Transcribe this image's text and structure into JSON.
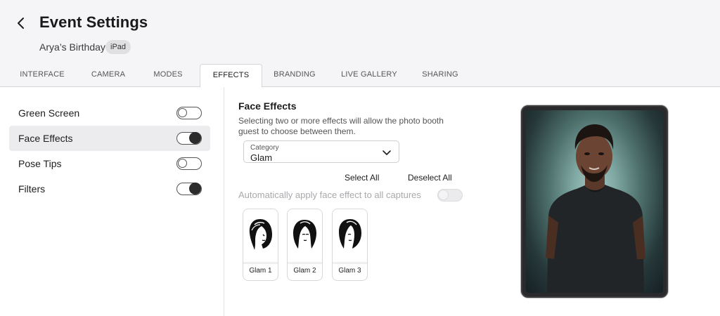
{
  "header": {
    "title": "Event Settings",
    "event_name": "Arya’s Birthday",
    "device_badge": "iPad"
  },
  "tabs": [
    {
      "label": "INTERFACE"
    },
    {
      "label": "CAMERA"
    },
    {
      "label": "MODES"
    },
    {
      "label": "EFFECTS",
      "active": true
    },
    {
      "label": "BRANDING"
    },
    {
      "label": "LIVE GALLERY"
    },
    {
      "label": "SHARING"
    }
  ],
  "sidebar": {
    "items": [
      {
        "label": "Green Screen",
        "on": false
      },
      {
        "label": "Face Effects",
        "on": true,
        "selected": true
      },
      {
        "label": "Pose Tips",
        "on": false
      },
      {
        "label": "Filters",
        "on": true
      }
    ]
  },
  "face_effects": {
    "title": "Face Effects",
    "description": "Selecting two or more effects will allow the photo booth guest to choose between them.",
    "category": {
      "label": "Category",
      "value": "Glam"
    },
    "select_all": "Select All",
    "deselect_all": "Deselect All",
    "auto_apply_label": "Automatically apply face effect to all captures",
    "auto_apply_on": false,
    "effects": [
      {
        "label": "Glam 1",
        "icon": "woman-silhouette-icon"
      },
      {
        "label": "Glam 2",
        "icon": "woman-silhouette-icon"
      },
      {
        "label": "Glam 3",
        "icon": "woman-silhouette-icon"
      }
    ]
  },
  "colors": {
    "header_bg": "#f5f5f7",
    "selected_bg": "#ececee",
    "toggle_on": "#2b2b2b"
  }
}
